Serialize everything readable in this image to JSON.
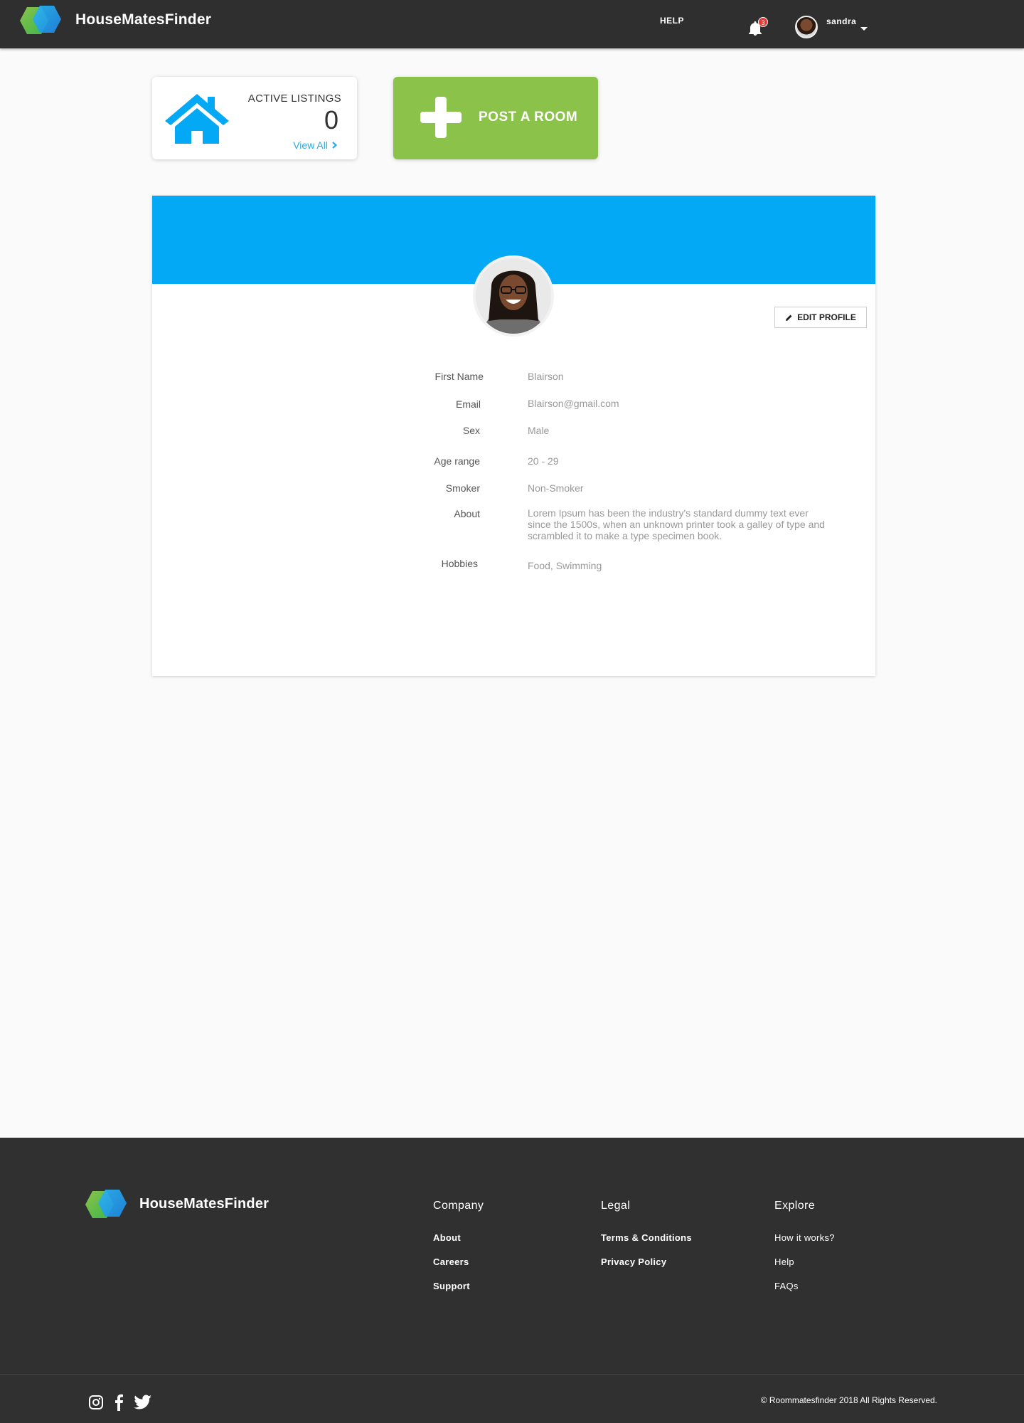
{
  "header": {
    "brand": "HouseMatesFinder",
    "help": "HELP",
    "notification_count": "3",
    "username": "sandra"
  },
  "listings": {
    "title": "ACTIVE LISTINGS",
    "count": "0",
    "view_all": "View All"
  },
  "post_room": {
    "label": "POST A ROOM"
  },
  "profile": {
    "edit_label": "EDIT PROFILE",
    "fields": [
      {
        "label": "First Name",
        "value": "Blairson"
      },
      {
        "label": "Email",
        "value": "Blairson@gmail.com"
      },
      {
        "label": "Sex",
        "value": "Male"
      },
      {
        "label": "Age range",
        "value": "20 - 29"
      },
      {
        "label": "Smoker",
        "value": "Non-Smoker"
      },
      {
        "label": "About",
        "value": "Lorem Ipsum has been the industry's standard dummy text ever since the 1500s, when an unknown printer took a galley of type and scrambled it to make a type specimen book."
      },
      {
        "label": "Hobbies",
        "value": "Food, Swimming"
      }
    ]
  },
  "footer": {
    "brand": "HouseMatesFinder",
    "company": {
      "title": "Company",
      "links": [
        "About",
        "Careers",
        "Support"
      ]
    },
    "legal": {
      "title": "Legal",
      "links": [
        "Terms & Conditions",
        "Privacy Policy"
      ]
    },
    "explore": {
      "title": "Explore",
      "links": [
        "How it works?",
        "Help",
        "FAQs"
      ]
    },
    "copyright": "© Roommatesfinder 2018 All Rights Reserved."
  },
  "colors": {
    "header_bg": "#2f2f2f",
    "brand_blue": "#03a9f4",
    "brand_green": "#8bc34a",
    "link_blue": "#29abe2",
    "badge_red": "#e53935"
  },
  "icons": [
    "logo-mark",
    "bell-icon",
    "house-icon",
    "chevron-right-icon",
    "plus-icon",
    "pencil-icon",
    "instagram-icon",
    "facebook-icon",
    "twitter-icon"
  ]
}
